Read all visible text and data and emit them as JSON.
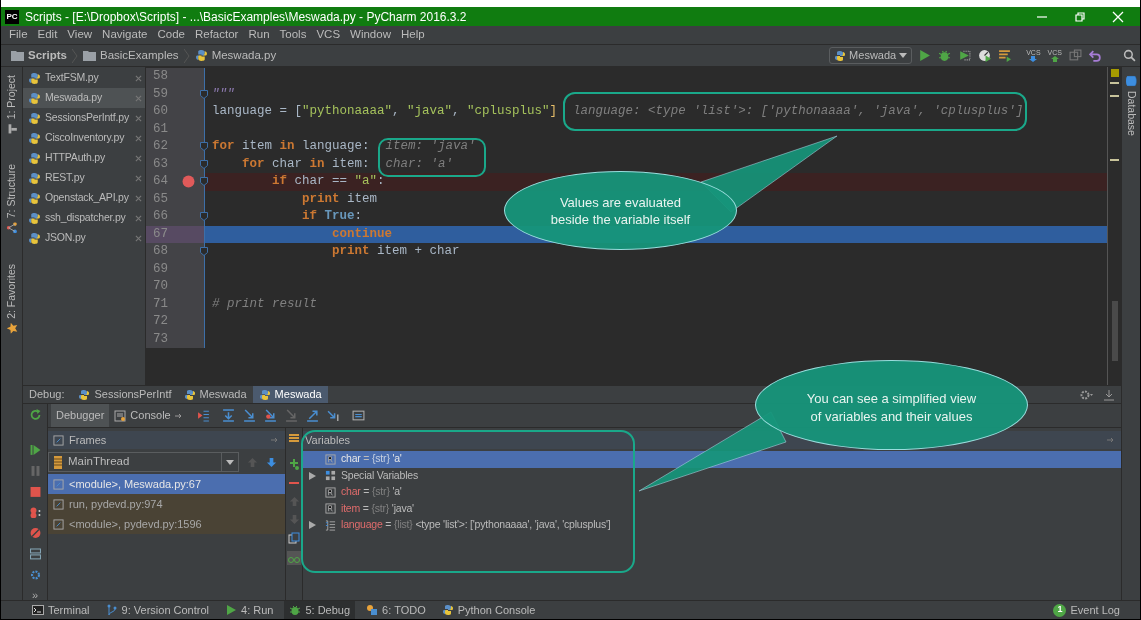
{
  "window": {
    "logo": "PC",
    "title": "Scripts - [E:\\Dropbox\\Scripts] - ...\\BasicExamples\\Meswada.py - PyCharm 2016.3.2"
  },
  "menu": [
    "File",
    "Edit",
    "View",
    "Navigate",
    "Code",
    "Refactor",
    "Run",
    "Tools",
    "VCS",
    "Window",
    "Help"
  ],
  "breadcrumbs": [
    {
      "label": "Scripts",
      "kind": "folder"
    },
    {
      "label": "BasicExamples",
      "kind": "folder"
    },
    {
      "label": "Meswada.py",
      "kind": "file"
    }
  ],
  "toolbar": {
    "run_configuration": "Meswada",
    "vcs_labels": [
      "VCS",
      "VCS"
    ]
  },
  "left_tool_windows": [
    {
      "label": "1: Project",
      "kind": "project"
    },
    {
      "label": "7: Structure",
      "kind": "structure"
    },
    {
      "label": "2: Favorites",
      "kind": "favorites"
    }
  ],
  "right_tool_windows": [
    {
      "label": "Database"
    }
  ],
  "open_files": [
    {
      "label": "TextFSM.py",
      "selected": false
    },
    {
      "label": "Meswada.py",
      "selected": true
    },
    {
      "label": "SessionsPerIntf.py",
      "selected": false
    },
    {
      "label": "CiscoInventory.py",
      "selected": false
    },
    {
      "label": "HTTPAuth.py",
      "selected": false
    },
    {
      "label": "REST.py",
      "selected": false
    },
    {
      "label": "Openstack_API.py",
      "selected": false
    },
    {
      "label": "ssh_dispatcher.py",
      "selected": false
    },
    {
      "label": "JSON.py",
      "selected": false
    }
  ],
  "editor": {
    "lines": [
      {
        "number": "58",
        "breakpoint": false,
        "current": false,
        "fold": false
      },
      {
        "number": "59",
        "tokens": [
          {
            "kind": "doc",
            "text": "\"\"\""
          }
        ],
        "breakpoint": false,
        "current": false,
        "fold": true
      },
      {
        "number": "60",
        "tokens": [
          {
            "kind": "plain",
            "text": "language = ["
          },
          {
            "kind": "string",
            "text": "\"pythonaaaa\""
          },
          {
            "kind": "plain",
            "text": ", "
          },
          {
            "kind": "string",
            "text": "\"java\""
          },
          {
            "kind": "plain",
            "text": ", "
          },
          {
            "kind": "string",
            "text": "\"cplusplus\""
          },
          {
            "kind": "bracket",
            "text": "]"
          }
        ],
        "hint": "language: <type 'list'>: ['pythonaaaa', 'java', 'cplusplus']",
        "breakpoint": false,
        "current": false,
        "fold": false
      },
      {
        "number": "61",
        "breakpoint": false,
        "current": false,
        "fold": false
      },
      {
        "number": "62",
        "tokens": [
          {
            "kind": "keyword",
            "text": "for"
          },
          {
            "kind": "plain",
            "text": " item "
          },
          {
            "kind": "keyword",
            "text": "in"
          },
          {
            "kind": "plain",
            "text": " language:"
          }
        ],
        "hint": "item: 'java'",
        "breakpoint": false,
        "current": false,
        "fold": true
      },
      {
        "number": "63",
        "tokens": [
          {
            "kind": "keyword",
            "text": "    for"
          },
          {
            "kind": "plain",
            "text": " char "
          },
          {
            "kind": "keyword",
            "text": "in"
          },
          {
            "kind": "plain",
            "text": " item:"
          }
        ],
        "hint": "char: 'a'",
        "breakpoint": false,
        "current": false,
        "fold": true
      },
      {
        "number": "64",
        "tokens": [
          {
            "kind": "keyword",
            "text": "        if"
          },
          {
            "kind": "plain",
            "text": " char == "
          },
          {
            "kind": "string",
            "text": "\"a\""
          },
          {
            "kind": "plain",
            "text": ":"
          }
        ],
        "breakpoint": true,
        "current": false,
        "fold": true
      },
      {
        "number": "65",
        "tokens": [
          {
            "kind": "keyword",
            "text": "            print"
          },
          {
            "kind": "plain",
            "text": " item"
          }
        ],
        "breakpoint": false,
        "current": false,
        "fold": false
      },
      {
        "number": "66",
        "tokens": [
          {
            "kind": "keyword",
            "text": "            if "
          },
          {
            "kind": "constant",
            "text": "True"
          },
          {
            "kind": "plain",
            "text": ":"
          }
        ],
        "breakpoint": false,
        "current": false,
        "fold": true
      },
      {
        "number": "67",
        "tokens": [
          {
            "kind": "keyword",
            "text": "                continue"
          }
        ],
        "breakpoint": false,
        "current": true,
        "fold": false
      },
      {
        "number": "68",
        "tokens": [
          {
            "kind": "keyword",
            "text": "                print"
          },
          {
            "kind": "plain",
            "text": " item + char"
          }
        ],
        "breakpoint": false,
        "current": false,
        "fold": true
      },
      {
        "number": "69",
        "breakpoint": false,
        "current": false,
        "fold": false
      },
      {
        "number": "70",
        "breakpoint": false,
        "current": false,
        "fold": false
      },
      {
        "number": "71",
        "tokens": [
          {
            "kind": "comment",
            "text": "# print result"
          }
        ],
        "breakpoint": false,
        "current": false,
        "fold": false
      },
      {
        "number": "72",
        "breakpoint": false,
        "current": false,
        "fold": false
      },
      {
        "number": "73",
        "breakpoint": false,
        "current": false,
        "fold": false
      }
    ]
  },
  "debug": {
    "label": "Debug:",
    "tabs": [
      {
        "label": "SessionsPerIntf",
        "selected": false
      },
      {
        "label": "Meswada",
        "selected": false
      },
      {
        "label": "Meswada",
        "selected": true
      }
    ],
    "subtabs": [
      {
        "label": "Debugger",
        "selected": true,
        "kind": "debugger"
      },
      {
        "label": "Console",
        "selected": false,
        "kind": "console"
      }
    ],
    "more_label": "»",
    "frames": {
      "title": "Frames",
      "thread": "MainThread",
      "items": [
        {
          "label": "<module>, Meswada.py:67",
          "selected": true,
          "library": false
        },
        {
          "label": "run, pydevd.py:974",
          "selected": false,
          "library": true
        },
        {
          "label": "<module>, pydevd.py:1596",
          "selected": false,
          "library": true
        }
      ]
    },
    "variables": {
      "title": "Variables",
      "items": [
        {
          "kind": "str",
          "name": "char",
          "separator": "=",
          "type": "{str}",
          "value": "'a'",
          "selected": true,
          "changed": false,
          "expandable": false
        },
        {
          "kind": "group",
          "name": "Special Variables",
          "selected": false,
          "changed": false,
          "expandable": true
        },
        {
          "kind": "str",
          "name": "char",
          "separator": "=",
          "type": "{str}",
          "value": "'a'",
          "selected": false,
          "changed": true,
          "expandable": false
        },
        {
          "kind": "str",
          "name": "item",
          "separator": "=",
          "type": "{str}",
          "value": "'java'",
          "selected": false,
          "changed": true,
          "expandable": false
        },
        {
          "kind": "list",
          "name": "language",
          "separator": "=",
          "type": "{list}",
          "value": "<type 'list'>: ['pythonaaaa', 'java', 'cplusplus']",
          "selected": false,
          "changed": true,
          "expandable": true
        }
      ]
    }
  },
  "bottom_tool_windows": [
    {
      "label": "Terminal",
      "kind": "terminal",
      "selected": false
    },
    {
      "label": "9: Version Control",
      "kind": "vcs",
      "selected": false
    },
    {
      "label": "4: Run",
      "kind": "run",
      "selected": false
    },
    {
      "label": "5: Debug",
      "kind": "debug",
      "selected": true
    },
    {
      "label": "6: TODO",
      "kind": "todo",
      "selected": false
    },
    {
      "label": "Python Console",
      "kind": "python",
      "selected": false
    }
  ],
  "event_log": {
    "count": "1",
    "label": "Event Log"
  },
  "callouts": [
    {
      "text": "Values are evaluated beside the variable itself"
    },
    {
      "text": "You can see a simplified view of variables and their values"
    }
  ]
}
